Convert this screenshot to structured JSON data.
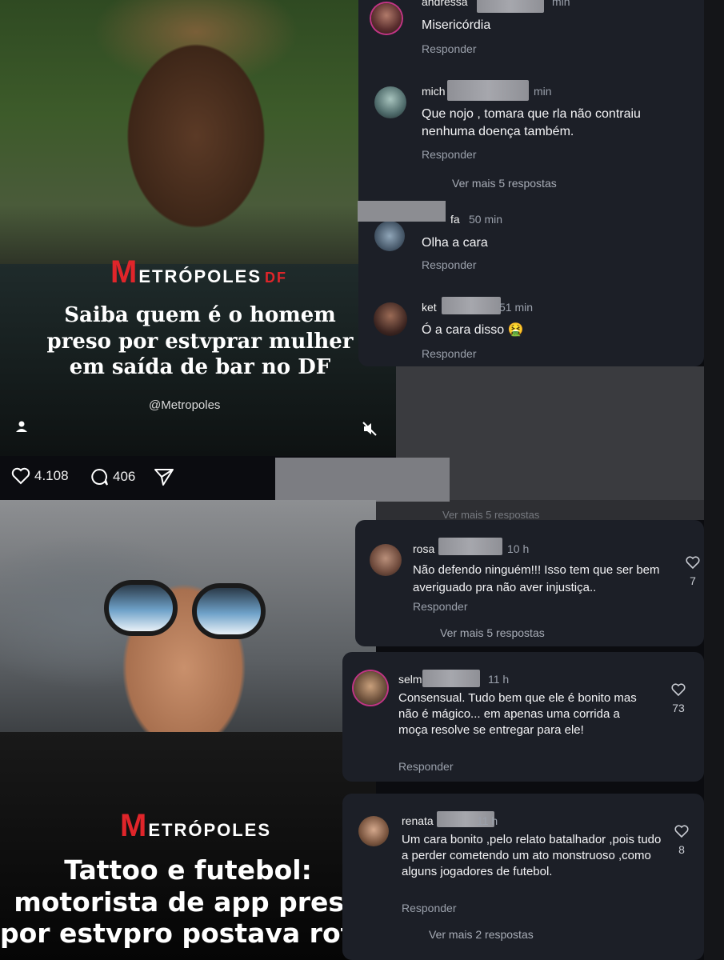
{
  "post_top": {
    "brand_m": "M",
    "brand_rest": "ETRÓPOLES",
    "brand_df": "DF",
    "headline": "Saiba quem é o homem preso por estvprar mulher em saída de bar no DF",
    "handle": "@Metropoles",
    "likes": "4.108",
    "comments": "406"
  },
  "post_bottom": {
    "brand_m": "M",
    "brand_rest": "ETRÓPOLES",
    "headline": "Tattoo e futebol:\nmotorista de app preso\npor estvpro postava rotin..."
  },
  "panel_a": {
    "comments": [
      {
        "name": "andressa",
        "time": "min",
        "text": "Misericórdia",
        "reply": "Responder"
      },
      {
        "name": "mich",
        "time": "min",
        "text": "Que nojo , tomara que rla não contraiu nenhuma doença também.",
        "reply": "Responder"
      },
      {
        "name": "fa",
        "time": "50 min",
        "text": "Olha a cara",
        "reply": "Responder"
      },
      {
        "name": "ket",
        "time": "51 min",
        "text": "Ó a cara disso 🤮",
        "reply": "Responder"
      }
    ],
    "see_more": "Ver mais 5 respostas"
  },
  "cut_text": "Ver mais 5 respostas",
  "panel_b": {
    "name": "rosa",
    "time": "10 h",
    "text": "Não defendo ninguém!!! Isso tem que ser bem averiguado pra não aver injustiça..",
    "reply": "Responder",
    "likes": "7",
    "see_more": "Ver mais 5 respostas"
  },
  "panel_c": {
    "name": "selm",
    "time": "11 h",
    "text": "Consensual. Tudo bem que ele é bonito mas não é mágico... em apenas uma corrida a moça resolve se entregar para ele!",
    "reply": "Responder",
    "likes": "73"
  },
  "panel_d": {
    "name": "renata",
    "time": "11 h",
    "text": "Um cara bonito ,pelo relato batalhador ,pois tudo a perder cometendo um ato monstruoso ,como alguns jogadores de futebol.",
    "reply": "Responder",
    "likes": "8",
    "see_more": "Ver mais 2 respostas"
  },
  "colors": {
    "brand_red": "#e0252a",
    "panel_bg": "#1c1f27",
    "muted_text": "#9aa0ab"
  },
  "icons": [
    "heart-icon",
    "comment-bubble-icon",
    "share-send-icon",
    "user-icon",
    "mute-icon"
  ]
}
